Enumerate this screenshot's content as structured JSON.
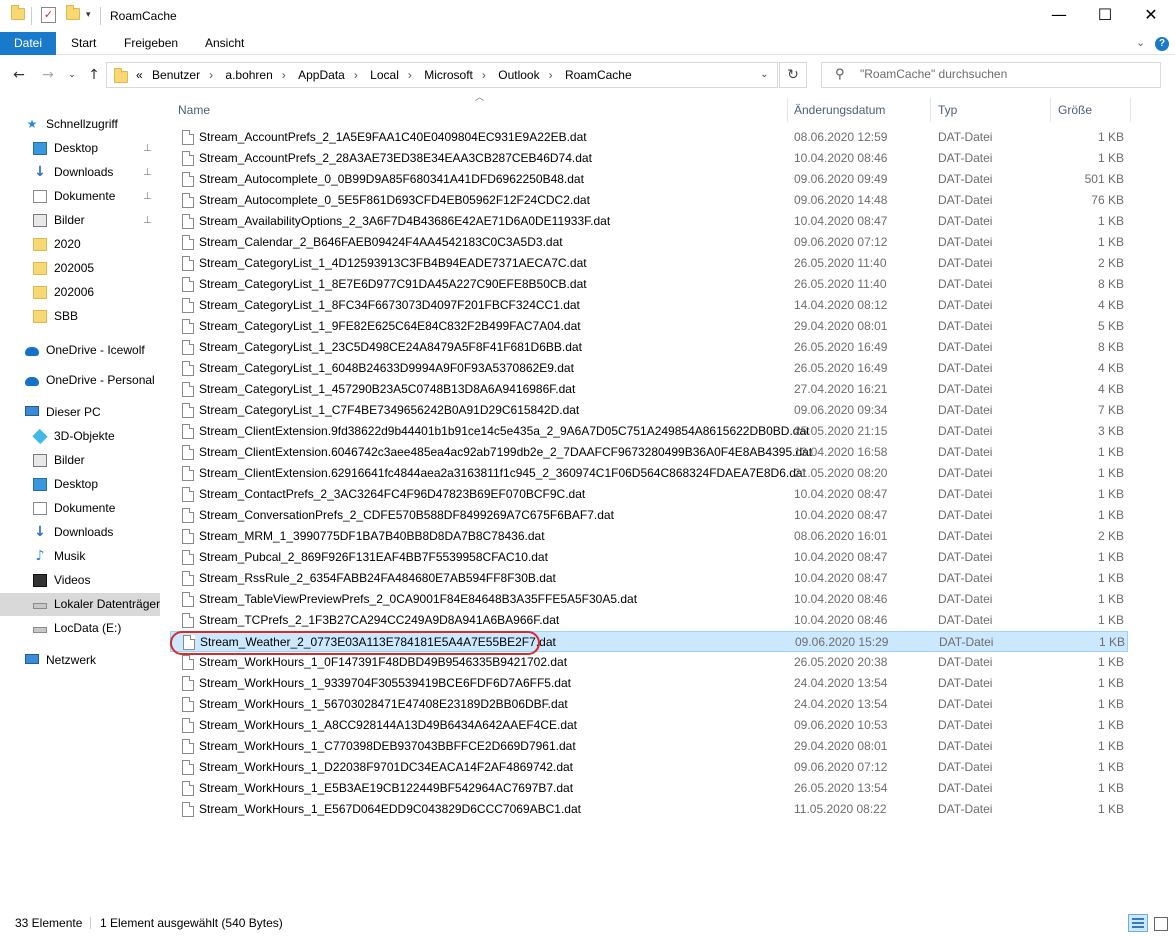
{
  "window": {
    "title": "RoamCache",
    "minimize": "—",
    "maximize": "☐",
    "close": "✕"
  },
  "ribbon": {
    "tabs": [
      "Datei",
      "Start",
      "Freigeben",
      "Ansicht"
    ]
  },
  "address": {
    "prefix": "«",
    "crumbs": [
      "Benutzer",
      "a.bohren",
      "AppData",
      "Local",
      "Microsoft",
      "Outlook",
      "RoamCache"
    ]
  },
  "search": {
    "placeholder": "\"RoamCache\" durchsuchen"
  },
  "sidebar": {
    "items": [
      {
        "label": "Schnellzugriff",
        "icon": "star-icon",
        "level": 0,
        "pinned": false
      },
      {
        "label": "Desktop",
        "icon": "desktop-icon",
        "level": 1,
        "pinned": true
      },
      {
        "label": "Downloads",
        "icon": "download-icon",
        "level": 1,
        "pinned": true
      },
      {
        "label": "Dokumente",
        "icon": "documents-icon",
        "level": 1,
        "pinned": true
      },
      {
        "label": "Bilder",
        "icon": "pictures-icon",
        "level": 1,
        "pinned": true
      },
      {
        "label": "2020",
        "icon": "folder-icon",
        "level": 1,
        "pinned": false
      },
      {
        "label": "202005",
        "icon": "folder-icon",
        "level": 1,
        "pinned": false
      },
      {
        "label": "202006",
        "icon": "folder-icon",
        "level": 1,
        "pinned": false
      },
      {
        "label": "SBB",
        "icon": "folder-icon",
        "level": 1,
        "pinned": false
      },
      {
        "label": "OneDrive - Icewolf",
        "icon": "onedrive-icon",
        "level": 0,
        "pinned": false
      },
      {
        "label": "OneDrive - Personal",
        "icon": "onedrive-icon",
        "level": 0,
        "pinned": false
      },
      {
        "label": "Dieser PC",
        "icon": "pc-icon",
        "level": 0,
        "pinned": false
      },
      {
        "label": "3D-Objekte",
        "icon": "3d-objects-icon",
        "level": 1,
        "pinned": false
      },
      {
        "label": "Bilder",
        "icon": "pictures-icon",
        "level": 1,
        "pinned": false
      },
      {
        "label": "Desktop",
        "icon": "desktop-icon",
        "level": 1,
        "pinned": false
      },
      {
        "label": "Dokumente",
        "icon": "documents-icon",
        "level": 1,
        "pinned": false
      },
      {
        "label": "Downloads",
        "icon": "download-icon",
        "level": 1,
        "pinned": false
      },
      {
        "label": "Musik",
        "icon": "music-icon",
        "level": 1,
        "pinned": false
      },
      {
        "label": "Videos",
        "icon": "videos-icon",
        "level": 1,
        "pinned": false
      },
      {
        "label": "Lokaler Datenträger",
        "icon": "drive-icon",
        "level": 1,
        "pinned": false,
        "selected": true
      },
      {
        "label": "LocData (E:)",
        "icon": "drive-icon",
        "level": 1,
        "pinned": false
      },
      {
        "label": "Netzwerk",
        "icon": "network-icon",
        "level": 0,
        "pinned": false
      }
    ]
  },
  "columns": {
    "name": "Name",
    "date": "Änderungsdatum",
    "type": "Typ",
    "size": "Größe"
  },
  "files": [
    {
      "name": "Stream_AccountPrefs_2_1A5E9FAA1C40E0409804EC931E9A22EB.dat",
      "date": "08.06.2020 12:59",
      "type": "DAT-Datei",
      "size": "1 KB"
    },
    {
      "name": "Stream_AccountPrefs_2_28A3AE73ED38E34EAA3CB287CEB46D74.dat",
      "date": "10.04.2020 08:46",
      "type": "DAT-Datei",
      "size": "1 KB"
    },
    {
      "name": "Stream_Autocomplete_0_0B99D9A85F680341A41DFD6962250B48.dat",
      "date": "09.06.2020 09:49",
      "type": "DAT-Datei",
      "size": "501 KB"
    },
    {
      "name": "Stream_Autocomplete_0_5E5F861D693CFD4EB05962F12F24CDC2.dat",
      "date": "09.06.2020 14:48",
      "type": "DAT-Datei",
      "size": "76 KB"
    },
    {
      "name": "Stream_AvailabilityOptions_2_3A6F7D4B43686E42AE71D6A0DE11933F.dat",
      "date": "10.04.2020 08:47",
      "type": "DAT-Datei",
      "size": "1 KB"
    },
    {
      "name": "Stream_Calendar_2_B646FAEB09424F4AA4542183C0C3A5D3.dat",
      "date": "09.06.2020 07:12",
      "type": "DAT-Datei",
      "size": "1 KB"
    },
    {
      "name": "Stream_CategoryList_1_4D12593913C3FB4B94EADE7371AECA7C.dat",
      "date": "26.05.2020 11:40",
      "type": "DAT-Datei",
      "size": "2 KB"
    },
    {
      "name": "Stream_CategoryList_1_8E7E6D977C91DA45A227C90EFE8B50CB.dat",
      "date": "26.05.2020 11:40",
      "type": "DAT-Datei",
      "size": "8 KB"
    },
    {
      "name": "Stream_CategoryList_1_8FC34F6673073D4097F201FBCF324CC1.dat",
      "date": "14.04.2020 08:12",
      "type": "DAT-Datei",
      "size": "4 KB"
    },
    {
      "name": "Stream_CategoryList_1_9FE82E625C64E84C832F2B499FAC7A04.dat",
      "date": "29.04.2020 08:01",
      "type": "DAT-Datei",
      "size": "5 KB"
    },
    {
      "name": "Stream_CategoryList_1_23C5D498CE24A8479A5F8F41F681D6BB.dat",
      "date": "26.05.2020 16:49",
      "type": "DAT-Datei",
      "size": "8 KB"
    },
    {
      "name": "Stream_CategoryList_1_6048B24633D9994A9F0F93A5370862E9.dat",
      "date": "26.05.2020 16:49",
      "type": "DAT-Datei",
      "size": "4 KB"
    },
    {
      "name": "Stream_CategoryList_1_457290B23A5C0748B13D8A6A9416986F.dat",
      "date": "27.04.2020 16:21",
      "type": "DAT-Datei",
      "size": "4 KB"
    },
    {
      "name": "Stream_CategoryList_1_C7F4BE7349656242B0A91D29C615842D.dat",
      "date": "09.06.2020 09:34",
      "type": "DAT-Datei",
      "size": "7 KB"
    },
    {
      "name": "Stream_ClientExtension.9fd38622d9b44401b1b91ce14c5e435a_2_9A6A7D05C751A249854A8615622DB0BD.dat",
      "date": "25.05.2020 21:15",
      "type": "DAT-Datei",
      "size": "3 KB"
    },
    {
      "name": "Stream_ClientExtension.6046742c3aee485ea4ac92ab7199db2e_2_7DAAFCF9673280499B36A0F4E8AB4395.dat",
      "date": "13.04.2020 16:58",
      "type": "DAT-Datei",
      "size": "1 KB"
    },
    {
      "name": "Stream_ClientExtension.62916641fc4844aea2a3163811f1c945_2_360974C1F06D564C868324FDAEA7E8D6.dat",
      "date": "21.05.2020 08:20",
      "type": "DAT-Datei",
      "size": "1 KB"
    },
    {
      "name": "Stream_ContactPrefs_2_3AC3264FC4F96D47823B69EF070BCF9C.dat",
      "date": "10.04.2020 08:47",
      "type": "DAT-Datei",
      "size": "1 KB"
    },
    {
      "name": "Stream_ConversationPrefs_2_CDFE570B588DF8499269A7C675F6BAF7.dat",
      "date": "10.04.2020 08:47",
      "type": "DAT-Datei",
      "size": "1 KB"
    },
    {
      "name": "Stream_MRM_1_3990775DF1BA7B40BB8D8DA7B8C78436.dat",
      "date": "08.06.2020 16:01",
      "type": "DAT-Datei",
      "size": "2 KB"
    },
    {
      "name": "Stream_Pubcal_2_869F926F131EAF4BB7F5539958CFAC10.dat",
      "date": "10.04.2020 08:47",
      "type": "DAT-Datei",
      "size": "1 KB"
    },
    {
      "name": "Stream_RssRule_2_6354FABB24FA484680E7AB594FF8F30B.dat",
      "date": "10.04.2020 08:47",
      "type": "DAT-Datei",
      "size": "1 KB"
    },
    {
      "name": "Stream_TableViewPreviewPrefs_2_0CA9001F84E84648B3A35FFE5A5F30A5.dat",
      "date": "10.04.2020 08:46",
      "type": "DAT-Datei",
      "size": "1 KB"
    },
    {
      "name": "Stream_TCPrefs_2_1F3B27CA294CC249A9D8A941A6BA966F.dat",
      "date": "10.04.2020 08:46",
      "type": "DAT-Datei",
      "size": "1 KB"
    },
    {
      "name": "Stream_Weather_2_0773E03A113E784181E5A4A7E55BE2F7.dat",
      "date": "09.06.2020 15:29",
      "type": "DAT-Datei",
      "size": "1 KB",
      "selected": true
    },
    {
      "name": "Stream_WorkHours_1_0F147391F48DBD49B9546335B9421702.dat",
      "date": "26.05.2020 20:38",
      "type": "DAT-Datei",
      "size": "1 KB"
    },
    {
      "name": "Stream_WorkHours_1_9339704F305539419BCE6FDF6D7A6FF5.dat",
      "date": "24.04.2020 13:54",
      "type": "DAT-Datei",
      "size": "1 KB"
    },
    {
      "name": "Stream_WorkHours_1_56703028471E47408E23189D2BB06DBF.dat",
      "date": "24.04.2020 13:54",
      "type": "DAT-Datei",
      "size": "1 KB"
    },
    {
      "name": "Stream_WorkHours_1_A8CC928144A13D49B6434A642AAEF4CE.dat",
      "date": "09.06.2020 10:53",
      "type": "DAT-Datei",
      "size": "1 KB"
    },
    {
      "name": "Stream_WorkHours_1_C770398DEB937043BBFFCE2D669D7961.dat",
      "date": "29.04.2020 08:01",
      "type": "DAT-Datei",
      "size": "1 KB"
    },
    {
      "name": "Stream_WorkHours_1_D22038F9701DC34EACA14F2AF4869742.dat",
      "date": "09.06.2020 07:12",
      "type": "DAT-Datei",
      "size": "1 KB"
    },
    {
      "name": "Stream_WorkHours_1_E5B3AE19CB122449BF542964AC7697B7.dat",
      "date": "26.05.2020 13:54",
      "type": "DAT-Datei",
      "size": "1 KB"
    },
    {
      "name": "Stream_WorkHours_1_E567D064EDD9C043829D6CCC7069ABC1.dat",
      "date": "11.05.2020 08:22",
      "type": "DAT-Datei",
      "size": "1 KB"
    }
  ],
  "status": {
    "count": "33 Elemente",
    "selection": "1 Element ausgewählt (540 Bytes)"
  },
  "colors": {
    "accent": "#1979ca",
    "selection_bg": "#cce8ff",
    "highlight_ring": "#d62b2b"
  }
}
